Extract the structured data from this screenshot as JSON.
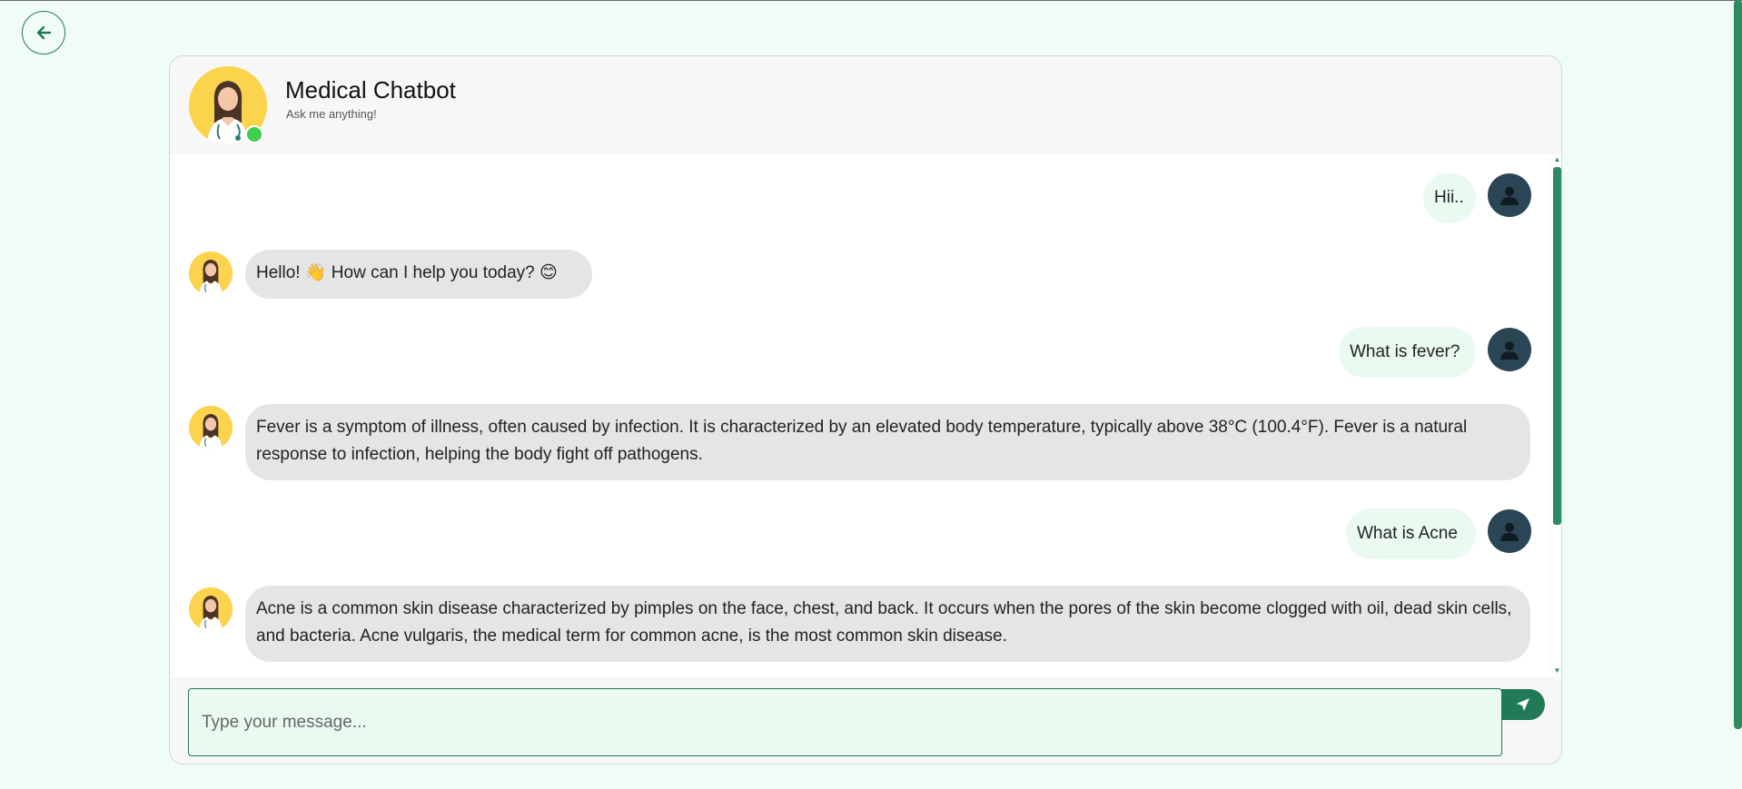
{
  "header": {
    "title": "Medical Chatbot",
    "subtitle": "Ask me anything!",
    "avatar_icon": "doctor-avatar-icon",
    "status": "online"
  },
  "messages": [
    {
      "sender": "user",
      "text": "Hii.."
    },
    {
      "sender": "bot",
      "text": "Hello! 👋 How can I help you today? 😊"
    },
    {
      "sender": "user",
      "text": "What is fever?"
    },
    {
      "sender": "bot",
      "text": "Fever is a symptom of illness, often caused by infection. It is characterized by an elevated body temperature, typically above 38°C (100.4°F). Fever is a natural response to infection, helping the body fight off pathogens."
    },
    {
      "sender": "user",
      "text": "What is Acne"
    },
    {
      "sender": "bot",
      "text": "Acne is a common skin disease characterized by pimples on the face, chest, and back. It occurs when the pores of the skin become clogged with oil, dead skin cells, and bacteria. Acne vulgaris, the medical term for common acne, is the most common skin disease."
    }
  ],
  "input": {
    "placeholder": "Type your message...",
    "value": ""
  },
  "icons": {
    "back": "arrow-left-icon",
    "send": "send-arrow-icon",
    "user": "user-avatar-icon"
  },
  "colors": {
    "accent": "#1f7a55",
    "page_background": "#f0fdf7",
    "user_bubble": "#eafaf1",
    "bot_bubble": "#e5e5e5",
    "online": "#3fcf4a",
    "avatar_bg": "#fcd34d",
    "user_avatar_bg": "#2a4654"
  }
}
